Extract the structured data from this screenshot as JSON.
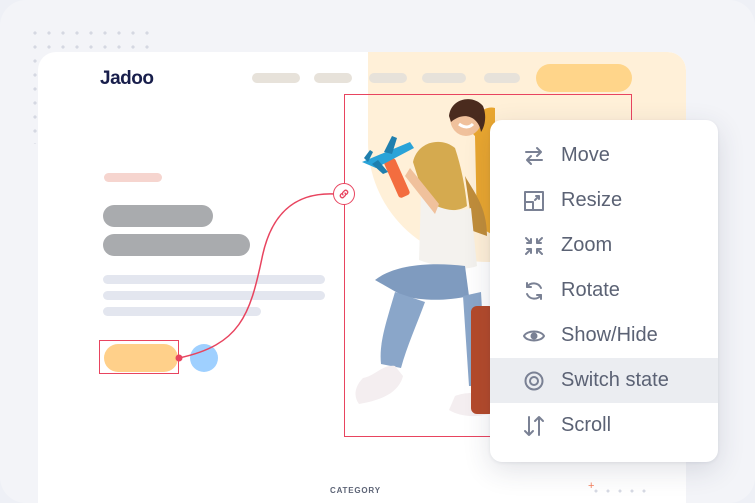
{
  "brand": {
    "logo": "Jadoo"
  },
  "page": {
    "category_label": "CATEGORY"
  },
  "colors": {
    "accent": "#e8445f",
    "peach": "#fff0d8",
    "button_yellow": "#ffd08a",
    "menu_text": "#5b6274",
    "menu_active_bg": "#ebedf1"
  },
  "context_menu": {
    "items": [
      {
        "label": "Move",
        "icon": "move-icon",
        "active": false
      },
      {
        "label": "Resize",
        "icon": "resize-icon",
        "active": false
      },
      {
        "label": "Zoom",
        "icon": "zoom-icon",
        "active": false
      },
      {
        "label": "Rotate",
        "icon": "rotate-icon",
        "active": false
      },
      {
        "label": "Show/Hide",
        "icon": "eye-icon",
        "active": false
      },
      {
        "label": "Switch state",
        "icon": "switch-state-icon",
        "active": true
      },
      {
        "label": "Scroll",
        "icon": "scroll-icon",
        "active": false
      }
    ]
  }
}
